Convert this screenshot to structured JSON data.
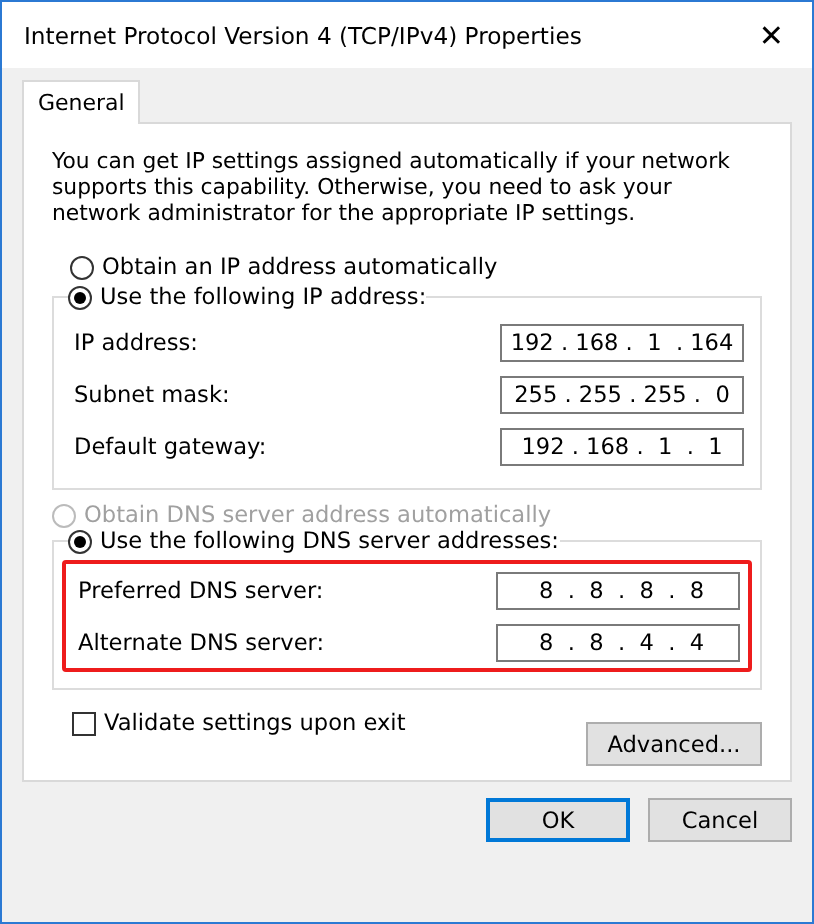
{
  "window": {
    "title": "Internet Protocol Version 4 (TCP/IPv4) Properties",
    "close": "✕"
  },
  "tabs": [
    {
      "label": "General",
      "selected": true
    }
  ],
  "intro": "You can get IP settings assigned automatically if your network supports this capability. Otherwise, you need to ask your network administrator for the appropriate IP settings.",
  "ip_mode": [
    {
      "label": "Obtain an IP address automatically",
      "selected": false,
      "disabled": false
    },
    {
      "label": "Use the following IP address:",
      "selected": true,
      "disabled": false
    }
  ],
  "ip_fields": [
    {
      "label": "IP address:",
      "value": "192 . 168 .  1  . 164"
    },
    {
      "label": "Subnet mask:",
      "value": "255 . 255 . 255 .  0"
    },
    {
      "label": "Default gateway:",
      "value": "192 . 168 .  1  .  1"
    }
  ],
  "dns_mode": [
    {
      "label": "Obtain DNS server address automatically",
      "selected": false,
      "disabled": true
    },
    {
      "label": "Use the following DNS server addresses:",
      "selected": true,
      "disabled": false
    }
  ],
  "dns_group": {
    "highlighted": true,
    "fields": [
      {
        "label": "Preferred DNS server:",
        "value": " 8  .  8  .  8  .  8"
      },
      {
        "label": "Alternate DNS server:",
        "value": " 8  .  8  .  4  .  4"
      }
    ]
  },
  "validate": {
    "label": "Validate settings upon exit",
    "checked": false
  },
  "advanced_button": "Advanced...",
  "buttons": [
    {
      "label": "OK",
      "default": true
    },
    {
      "label": "Cancel",
      "default": false
    }
  ]
}
